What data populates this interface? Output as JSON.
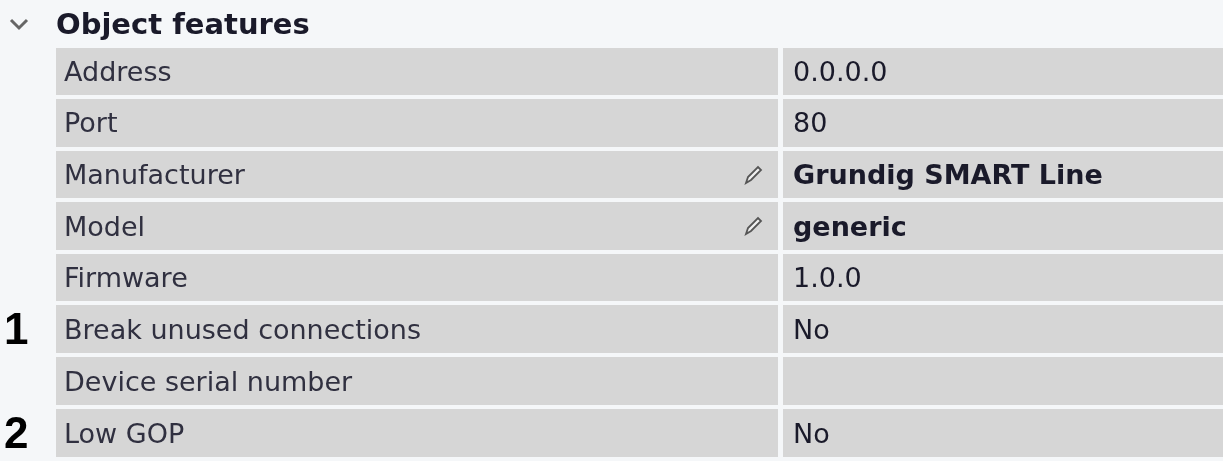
{
  "section": {
    "title": "Object features",
    "expanded": true
  },
  "rows": [
    {
      "name": "Address",
      "value": "0.0.0.0",
      "editable": false,
      "bold": false
    },
    {
      "name": "Port",
      "value": "80",
      "editable": false,
      "bold": false
    },
    {
      "name": "Manufacturer",
      "value": "Grundig SMART Line",
      "editable": true,
      "bold": true
    },
    {
      "name": "Model",
      "value": "generic",
      "editable": true,
      "bold": true
    },
    {
      "name": "Firmware",
      "value": "1.0.0",
      "editable": false,
      "bold": false
    },
    {
      "name": "Break unused connections",
      "value": "No",
      "editable": false,
      "bold": false,
      "callout": "1"
    },
    {
      "name": "Device serial number",
      "editable": false,
      "bold": false
    },
    {
      "name": "Low GOP",
      "value": "No",
      "editable": false,
      "bold": false,
      "callout": "2"
    }
  ]
}
